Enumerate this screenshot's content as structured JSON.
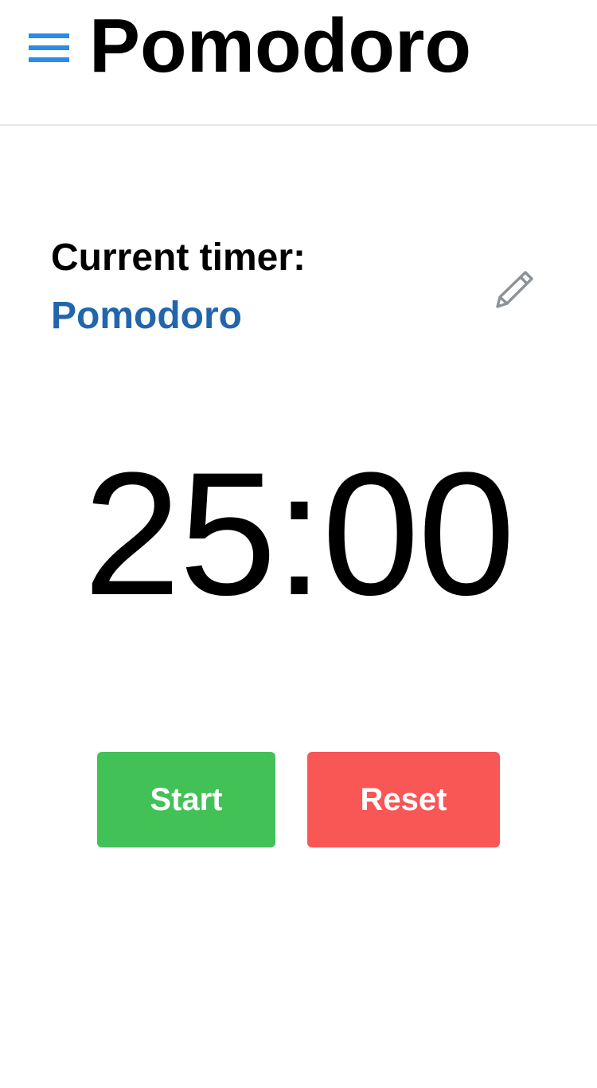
{
  "header": {
    "title": "Pomodoro",
    "menu_icon": "hamburger-menu-icon"
  },
  "timer": {
    "label": "Current timer:",
    "name": "Pomodoro",
    "edit_icon": "pencil-icon",
    "display": "25:00"
  },
  "controls": {
    "start_label": "Start",
    "reset_label": "Reset"
  },
  "colors": {
    "accent": "#2a8be8",
    "timer_name": "#2166ac",
    "start": "#42c157",
    "reset": "#f95656",
    "edit_icon": "#8a9299"
  }
}
